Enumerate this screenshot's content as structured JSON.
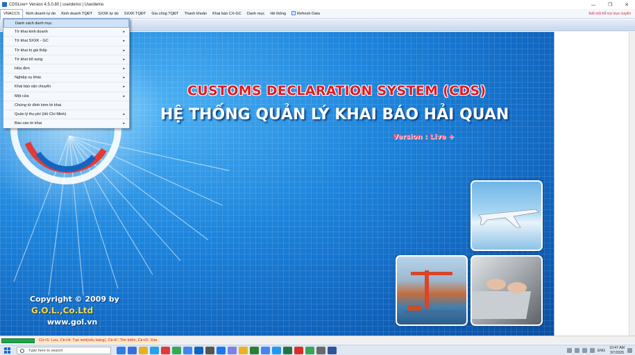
{
  "window": {
    "title": "CDSLive+ Version 4.5.0.80 | userdemo | Userdemo",
    "minimize": "—",
    "restore": "❐",
    "close": "✕"
  },
  "menubar": {
    "items": [
      "VNACCS",
      "Kinh doanh tự do",
      "Kinh doanh TQĐT",
      "SXXK tự do",
      "SXXK TQĐT",
      "Gia công TQĐT",
      "Thanh khoản",
      "Khai báo CX-GC",
      "Danh mục",
      "Hệ thống",
      "Refresh Data"
    ],
    "support_link": "Kết nối hỗ trợ trực tuyến"
  },
  "dropdown": {
    "items": [
      {
        "label": "Danh sách danh mục",
        "submenu": false
      },
      {
        "label": "Tờ khai kinh doanh",
        "submenu": true
      },
      {
        "label": "Tờ khai SXXK - GC",
        "submenu": true
      },
      {
        "label": "Tờ khai trị giá thấp",
        "submenu": true
      },
      {
        "label": "Tờ khai bổ sung",
        "submenu": true
      },
      {
        "label": "Hóa đơn",
        "submenu": true
      },
      {
        "label": "Nghiệp vụ khác",
        "submenu": true
      },
      {
        "label": "Khai báo vận chuyển",
        "submenu": true
      },
      {
        "label": "Một cửa",
        "submenu": true
      },
      {
        "label": "Chứng từ đính kèm tờ khai",
        "submenu": false
      },
      {
        "label": "Quản lý thu phí (Hồ Chí Minh)",
        "submenu": true
      },
      {
        "label": "Báo cáo tờ khai",
        "submenu": true
      }
    ],
    "arrow": "▸"
  },
  "banner": {
    "system_en": "CUSTOMS DECLARATION SYSTEM (CDS)",
    "system_vn": "HỆ THỐNG QUẢN LÝ KHAI BÁO HẢI QUAN",
    "version": "Version : Live +",
    "copyright": "Copyright © 2009 by",
    "company": "G.O.L.,Co.Ltd",
    "website": "www.gol.vn"
  },
  "statusbar": {
    "progress": 1.0,
    "hint": "Ctr+S: Lưu, Ctr+N: Tạo mới(nếu bảng), Ctr+F: Tìm kiếm, Ctr+D: Xóa"
  },
  "taskbar": {
    "search_placeholder": "Type here to search",
    "lang": "ENG",
    "time": "10:47 AM",
    "date": "3/7/2025",
    "pinned_colors": [
      "#2b7de9",
      "#3a6fd8",
      "#e8b020",
      "#24a0ed",
      "#e53935",
      "#34a853",
      "#4285f4",
      "#0a66c2",
      "#555555",
      "#1877f2",
      "#7b83eb",
      "#f2b01e",
      "#2e7d32",
      "#4285f4",
      "#2196f3",
      "#217346",
      "#d93025",
      "#34a853",
      "#6a6a6a",
      "#2b579a"
    ]
  },
  "colors": {
    "accent": "#1e86dd",
    "support_link": "#d3212c",
    "title_red": "#e21b23",
    "version_pink": "#ff4a6e",
    "progress_green": "#1fa64a"
  }
}
